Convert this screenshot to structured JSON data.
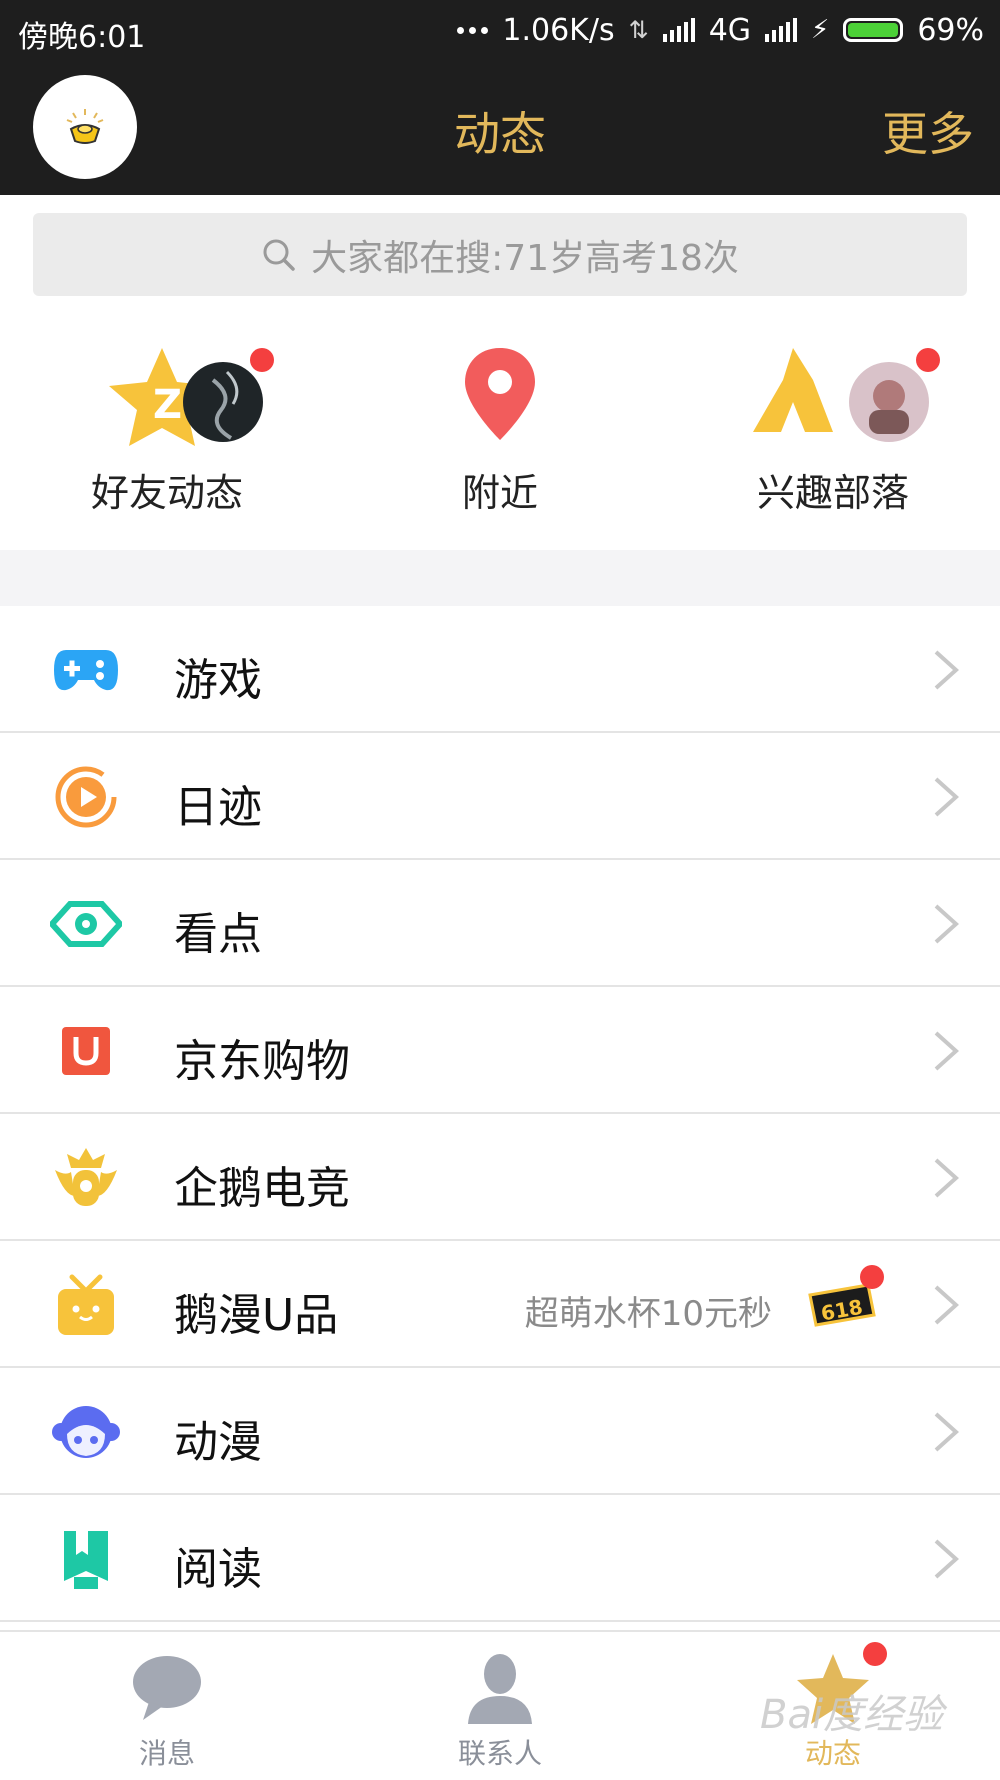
{
  "status_bar": {
    "time": "傍晚6:01",
    "speed": "1.06K/s",
    "network": "4G",
    "battery": "69%",
    "battery_color": "#4cd137"
  },
  "header": {
    "title": "动态",
    "more": "更多",
    "accent_color": "#e2b85b",
    "avatar_icon": "gold-ingot-icon"
  },
  "search": {
    "placeholder": "大家都在搜:71岁高考18次",
    "icon": "search-icon"
  },
  "quick_entries": [
    {
      "label": "好友动态",
      "icon": "qzone-star-icon",
      "has_red_dot": true
    },
    {
      "label": "附近",
      "icon": "location-pin-icon",
      "has_red_dot": false
    },
    {
      "label": "兴趣部落",
      "icon": "tent-icon",
      "has_red_dot": true
    }
  ],
  "list": [
    {
      "label": "游戏",
      "icon": "gamepad-icon"
    },
    {
      "label": "日迹",
      "icon": "play-circle-icon"
    },
    {
      "label": "看点",
      "icon": "eye-icon"
    },
    {
      "label": "京东购物",
      "icon": "jd-bag-icon"
    },
    {
      "label": "企鹅电竞",
      "icon": "esports-crown-icon"
    },
    {
      "label": "鹅漫U品",
      "icon": "gift-box-icon",
      "subtitle": "超萌水杯10元秒",
      "badge": "618",
      "has_red_dot": true
    },
    {
      "label": "动漫",
      "icon": "anime-face-icon"
    },
    {
      "label": "阅读",
      "icon": "bookmark-icon"
    }
  ],
  "bottom_nav": [
    {
      "label": "消息",
      "icon": "chat-bubble-icon",
      "active": false
    },
    {
      "label": "联系人",
      "icon": "person-icon",
      "active": false
    },
    {
      "label": "动态",
      "icon": "star-icon",
      "active": true,
      "has_red_dot": true
    }
  ],
  "watermark": "Bai度经验"
}
